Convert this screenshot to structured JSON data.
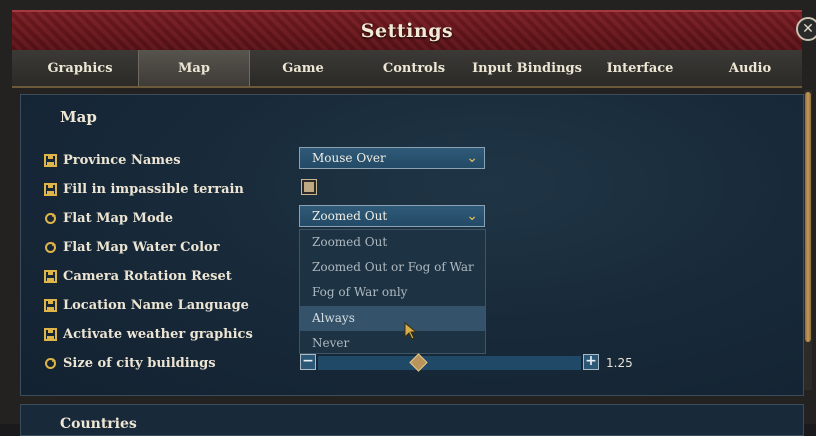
{
  "window": {
    "title": "Settings",
    "close_label": "✕"
  },
  "tabs": [
    {
      "label": "Graphics",
      "active": false
    },
    {
      "label": "Map",
      "active": true
    },
    {
      "label": "Game",
      "active": false
    },
    {
      "label": "Controls",
      "active": false
    },
    {
      "label": "Input Bindings",
      "active": false
    },
    {
      "label": "Interface",
      "active": false
    },
    {
      "label": "Audio",
      "active": false
    }
  ],
  "sections": [
    {
      "title": "Map"
    },
    {
      "title": "Countries"
    }
  ],
  "settings": [
    {
      "label": "Province Names",
      "icon": "save-icon",
      "control": "dropdown",
      "value": "Mouse Over"
    },
    {
      "label": "Fill in impassible terrain",
      "icon": "save-icon",
      "control": "checkbox",
      "checked": true
    },
    {
      "label": "Flat Map Mode",
      "icon": "refresh-icon",
      "control": "dropdown",
      "value": "Zoomed Out"
    },
    {
      "label": "Flat Map Water Color",
      "icon": "refresh-icon",
      "control": "none"
    },
    {
      "label": "Camera Rotation Reset",
      "icon": "save-icon",
      "control": "none"
    },
    {
      "label": "Location Name Language",
      "icon": "save-icon",
      "control": "none"
    },
    {
      "label": "Activate weather graphics",
      "icon": "save-icon",
      "control": "none"
    },
    {
      "label": "Size of city buildings",
      "icon": "refresh-icon",
      "control": "slider",
      "value_text": "1.25"
    }
  ],
  "flat_map_mode_options": [
    {
      "label": "Zoomed Out",
      "hover": false
    },
    {
      "label": "Zoomed Out or Fog of War",
      "hover": false
    },
    {
      "label": "Fog of War only",
      "hover": false
    },
    {
      "label": "Always",
      "hover": true
    },
    {
      "label": "Never",
      "hover": false
    }
  ],
  "slider": {
    "minus_label": "−",
    "plus_label": "+",
    "value_text": "1.25",
    "fraction": 0.38
  },
  "colors": {
    "accent_gold": "#e8c35a",
    "title_red": "#7a1c22",
    "panel_blue": "#172838"
  }
}
